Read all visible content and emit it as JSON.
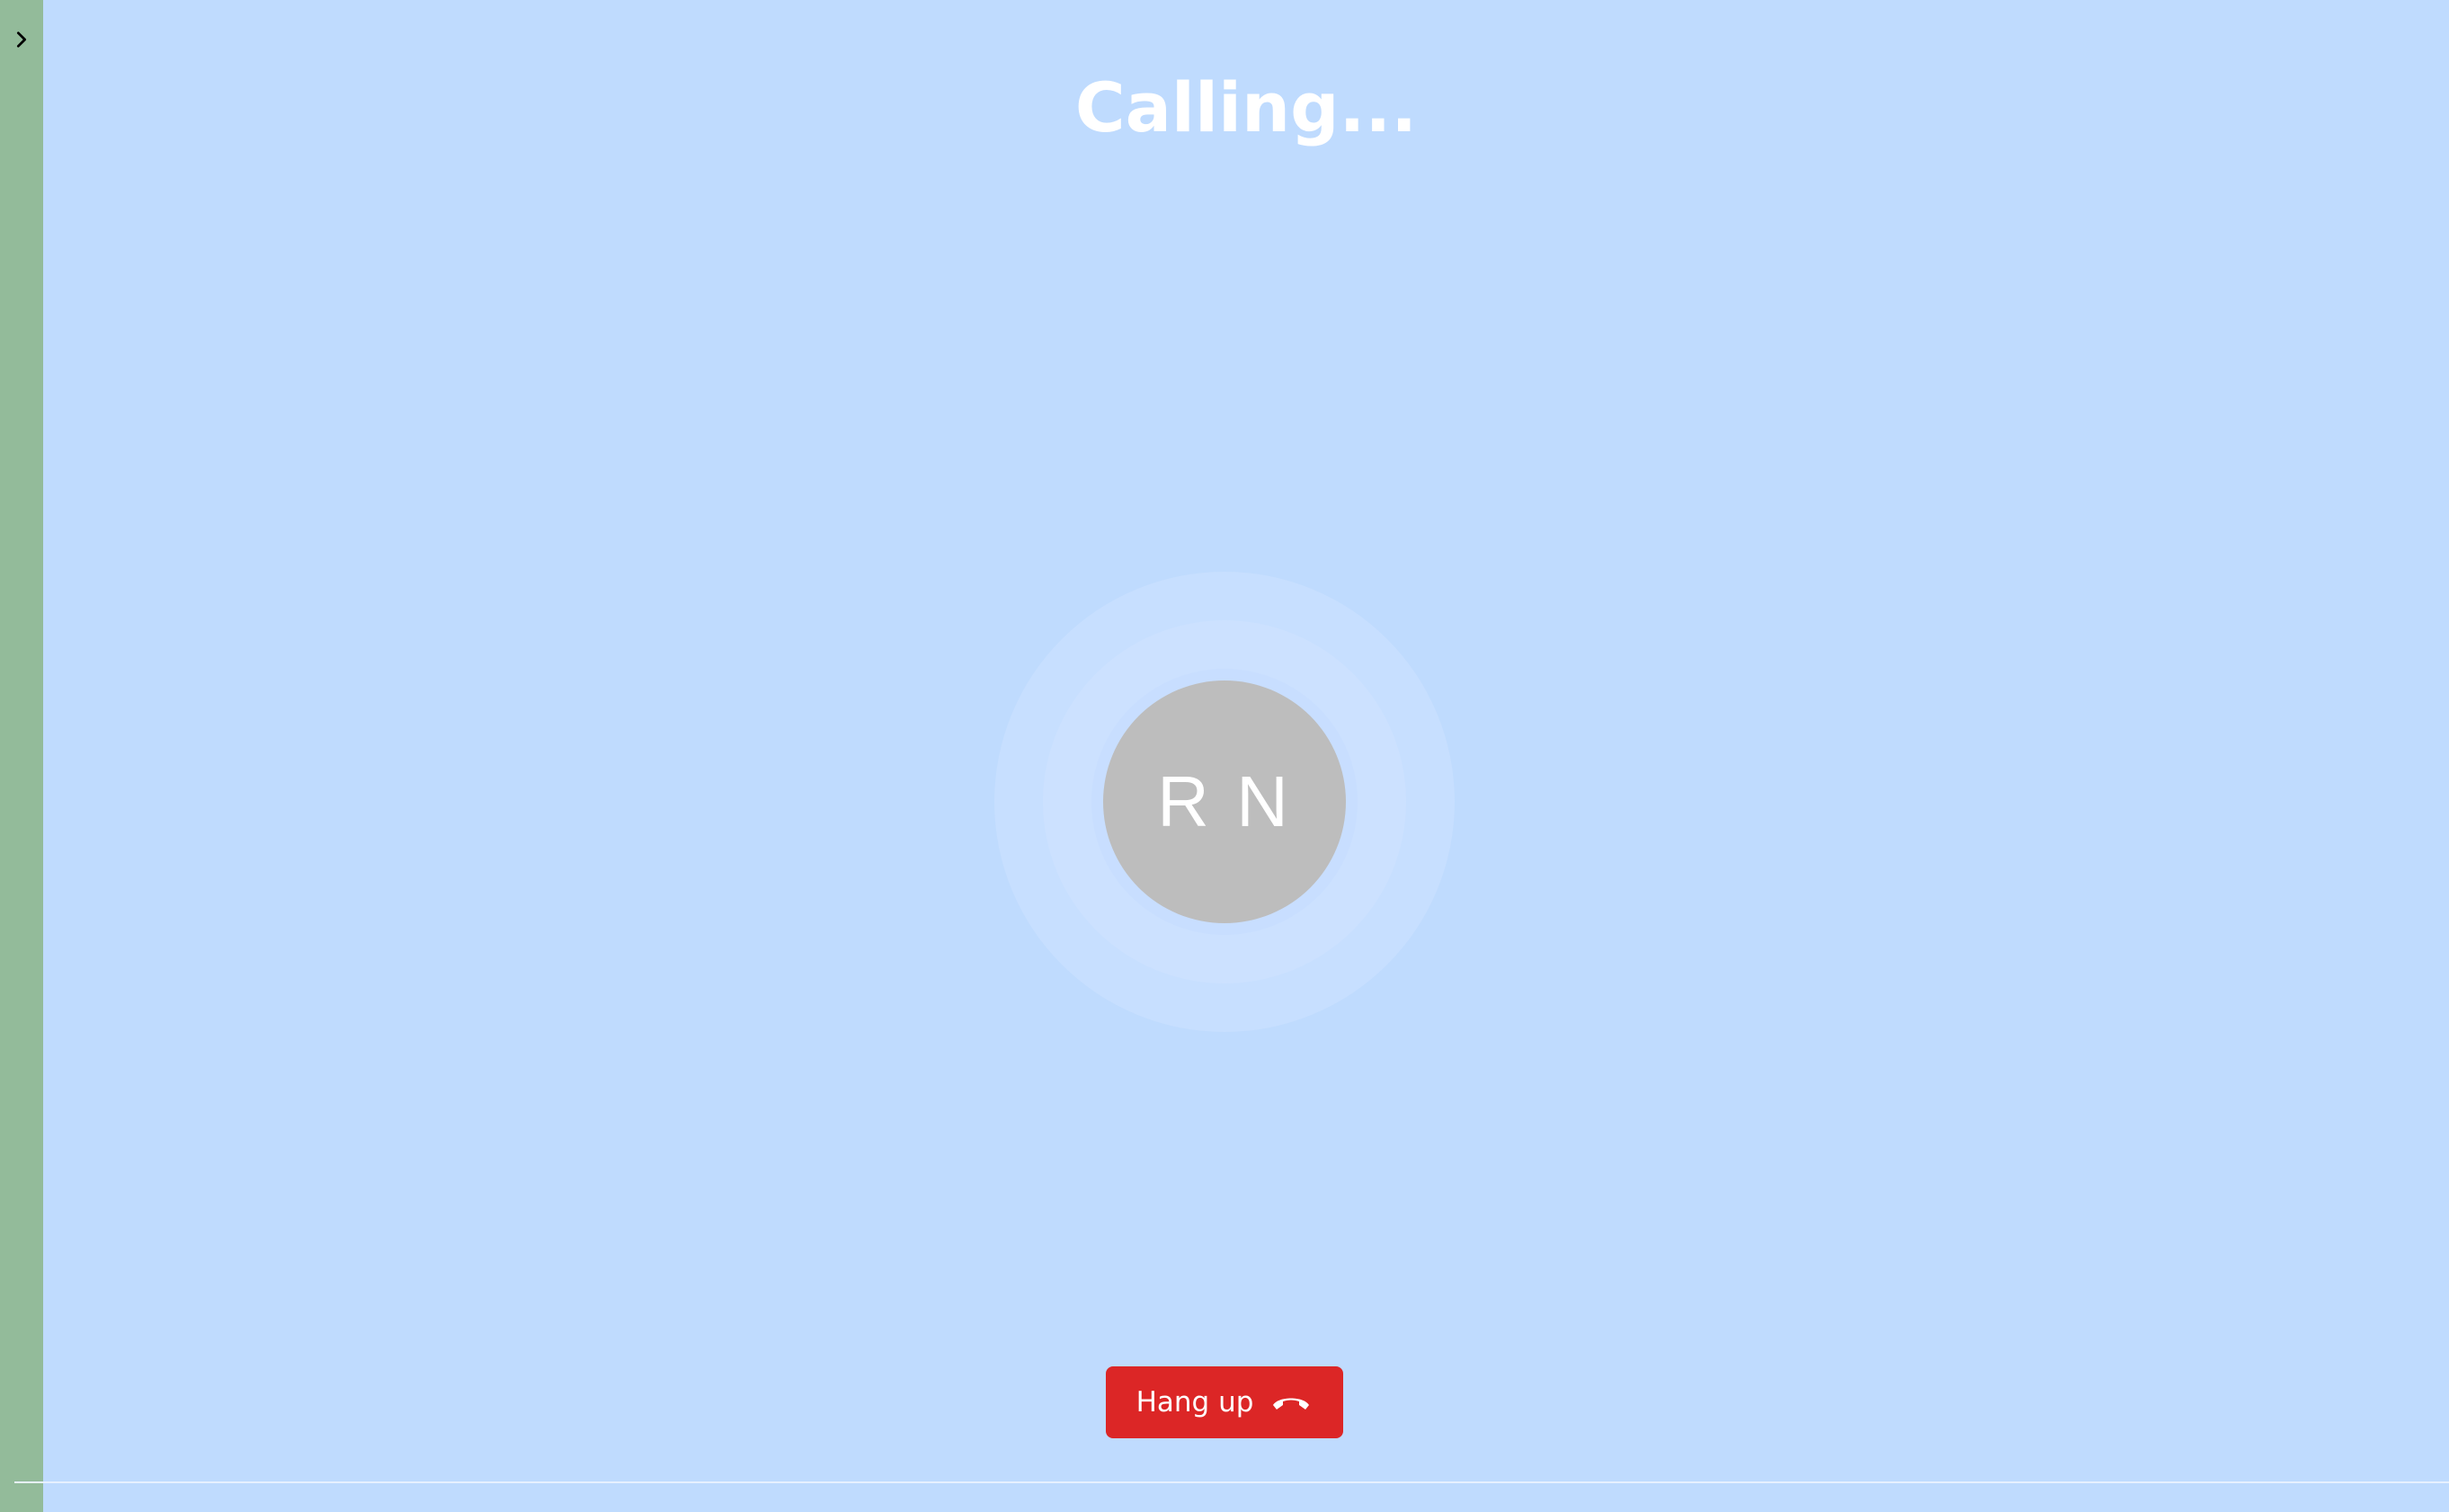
{
  "call": {
    "status_title": "Calling...",
    "contact_initials": "R N",
    "hangup_label": "Hang up"
  },
  "sidebar": {
    "toggle_icon": "chevron-right-icon"
  },
  "colors": {
    "background": "#bfdbfe",
    "sidebar": "#93bb9a",
    "avatar": "#bdbdbd",
    "hangup_button": "#dc2626",
    "text": "#ffffff"
  }
}
